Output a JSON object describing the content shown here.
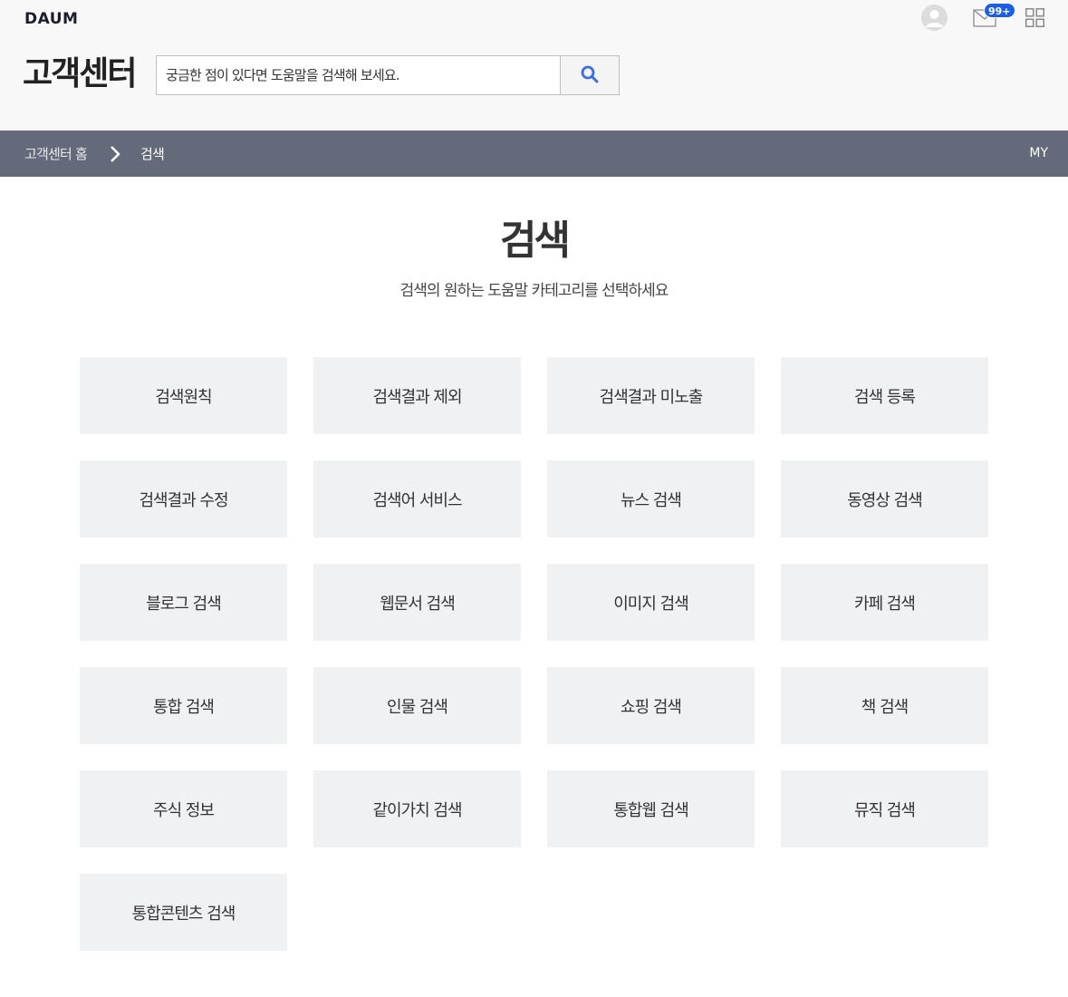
{
  "header": {
    "logo": "DAUM",
    "service_title": "고객센터",
    "search": {
      "placeholder": "궁금한 점이 있다면 도움말을 검색해 보세요."
    },
    "mail_badge": "99+"
  },
  "breadcrumb": {
    "home": "고객센터 홈",
    "current": "검색",
    "my": "MY"
  },
  "main": {
    "title": "검색",
    "description": "검색의 원하는 도움말 카테고리를 선택하세요",
    "categories": [
      "검색원칙",
      "검색결과 제외",
      "검색결과 미노출",
      "검색 등록",
      "검색결과 수정",
      "검색어 서비스",
      "뉴스 검색",
      "동영상 검색",
      "블로그 검색",
      "웹문서 검색",
      "이미지 검색",
      "카페 검색",
      "통합 검색",
      "인물 검색",
      "쇼핑 검색",
      "책 검색",
      "주식 정보",
      "같이가치 검색",
      "통합웹 검색",
      "뮤직 검색",
      "통합콘텐츠 검색"
    ]
  },
  "colors": {
    "crumb_bar": "#646a79",
    "card_bg": "#f0f1f3",
    "accent": "#1c5fe6",
    "search_icon": "#3b6fe0"
  },
  "icons": [
    "profile-icon",
    "mail-icon",
    "apps-grid-icon",
    "search-icon",
    "chevron-right-icon"
  ]
}
